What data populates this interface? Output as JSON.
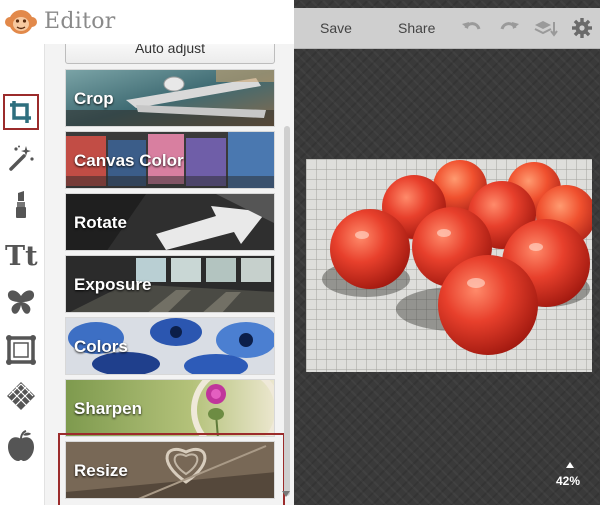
{
  "app": {
    "title": "Editor",
    "logo_icon": "monkey-logo-icon",
    "accent_color": "#9b2b2b"
  },
  "toolbar": {
    "save_label": "Save",
    "share_label": "Share",
    "icons": [
      "undo-icon",
      "redo-icon",
      "layers-icon",
      "gear-icon"
    ]
  },
  "tools": [
    {
      "name": "crop-tool",
      "icon": "crop-icon",
      "active": true
    },
    {
      "name": "effects-tool",
      "icon": "magic-wand-icon"
    },
    {
      "name": "touch-up-tool",
      "icon": "lipstick-icon"
    },
    {
      "name": "text-tool",
      "icon": "text-tt-icon"
    },
    {
      "name": "overlays-tool",
      "icon": "butterfly-icon"
    },
    {
      "name": "frames-tool",
      "icon": "frame-icon"
    },
    {
      "name": "textures-tool",
      "icon": "texture-icon"
    },
    {
      "name": "seasonal-tool",
      "icon": "apple-icon"
    }
  ],
  "panel": {
    "auto_adjust_label": "Auto adjust",
    "items": [
      {
        "label": "Crop"
      },
      {
        "label": "Canvas Color"
      },
      {
        "label": "Rotate"
      },
      {
        "label": "Exposure"
      },
      {
        "label": "Colors"
      },
      {
        "label": "Sharpen"
      },
      {
        "label": "Resize",
        "selected": true
      }
    ]
  },
  "canvas": {
    "zoom_label": "42%",
    "photo_subject": "red tomatoes on a checkered cloth"
  }
}
